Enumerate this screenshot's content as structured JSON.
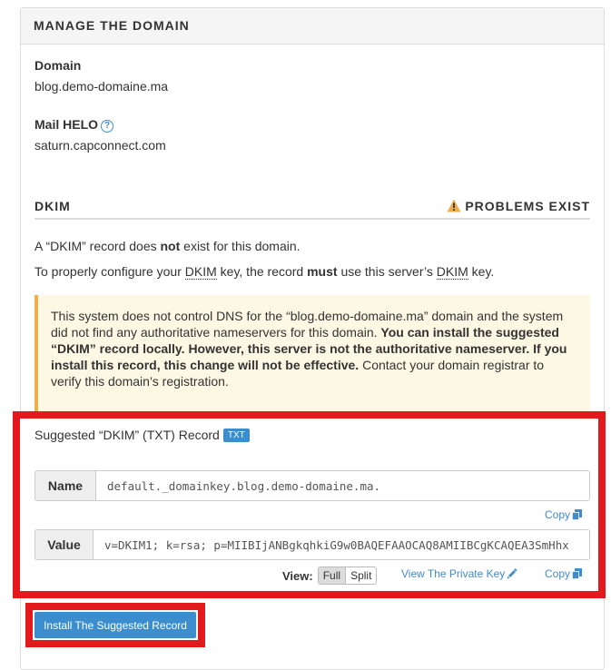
{
  "panel": {
    "title": "MANAGE THE DOMAIN"
  },
  "domain": {
    "label": "Domain",
    "value": "blog.demo-domaine.ma"
  },
  "helo": {
    "label": "Mail HELO",
    "help_icon": "?",
    "value": "saturn.capconnect.com"
  },
  "dkim": {
    "title": "DKIM",
    "status": "PROBLEMS EXIST",
    "status_color": "#f0ad4e",
    "line1": {
      "pre": "A “DKIM” record does ",
      "bold": "not",
      "post": " exist for this domain."
    },
    "line2": {
      "pre": "To properly configure your ",
      "abbr1": "DKIM",
      "mid": " key, the record ",
      "bold": "must",
      "mid2": " use this server’s ",
      "abbr2": "DKIM",
      "post": " key."
    },
    "alert": {
      "text1": "This system does not control DNS for the “blog.demo-domaine.ma” domain and the system did not find any authoritative nameservers for this domain. ",
      "bold": "You can install the suggested “DKIM” record locally. However, this server is not the authoritative nameserver. If you install this record, this change will not be effective.",
      "text2": " Contact your domain registrar to verify this domain’s registration."
    }
  },
  "suggested": {
    "title": "Suggested “DKIM” (TXT) Record",
    "badge": "TXT",
    "name_label": "Name",
    "name_value": "default._domainkey.blog.demo-domaine.ma.",
    "value_label": "Value",
    "value_value": "v=DKIM1; k=rsa; p=MIIBIjANBgkqhkiG9w0BAQEFAAOCAQ8AMIIBCgKCAQEA3SmHhx",
    "copy_label": "Copy",
    "view_label": "View:",
    "view_full": "Full",
    "view_split": "Split",
    "private_key_link": "View The Private Key",
    "highlight_color": "#e3191d"
  },
  "install_button": "Install The Suggested Record",
  "accent": "#3c8dcd"
}
